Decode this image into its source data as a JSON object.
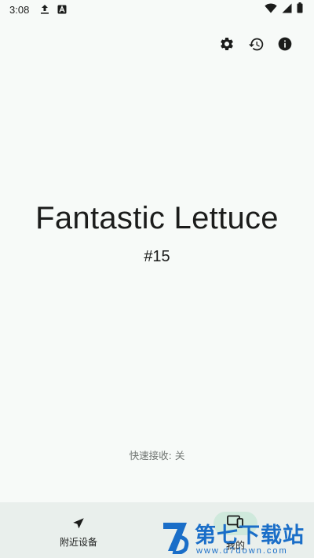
{
  "status_bar": {
    "time": "3:08",
    "icons_left": [
      "upload-icon",
      "a-badge-icon"
    ],
    "icons_right": [
      "wifi-icon",
      "signal-icon",
      "battery-icon"
    ]
  },
  "top_actions": [
    "settings-icon",
    "history-icon",
    "info-icon"
  ],
  "device": {
    "name": "Fantastic Lettuce",
    "number": "#15"
  },
  "quick_receive": "快速接收: 关",
  "bottom_nav": {
    "items": [
      {
        "label": "附近设备",
        "icon": "navigation-arrow-icon",
        "active": false
      },
      {
        "label": "我的",
        "icon": "devices-icon",
        "active": true
      }
    ]
  },
  "watermark": {
    "text": "第七下载站",
    "url": "www.d7down.com"
  },
  "colors": {
    "background": "#f7faf8",
    "nav_background": "#e9efec",
    "active_pill": "#cfe9dc",
    "watermark": "#1a6ec8"
  }
}
